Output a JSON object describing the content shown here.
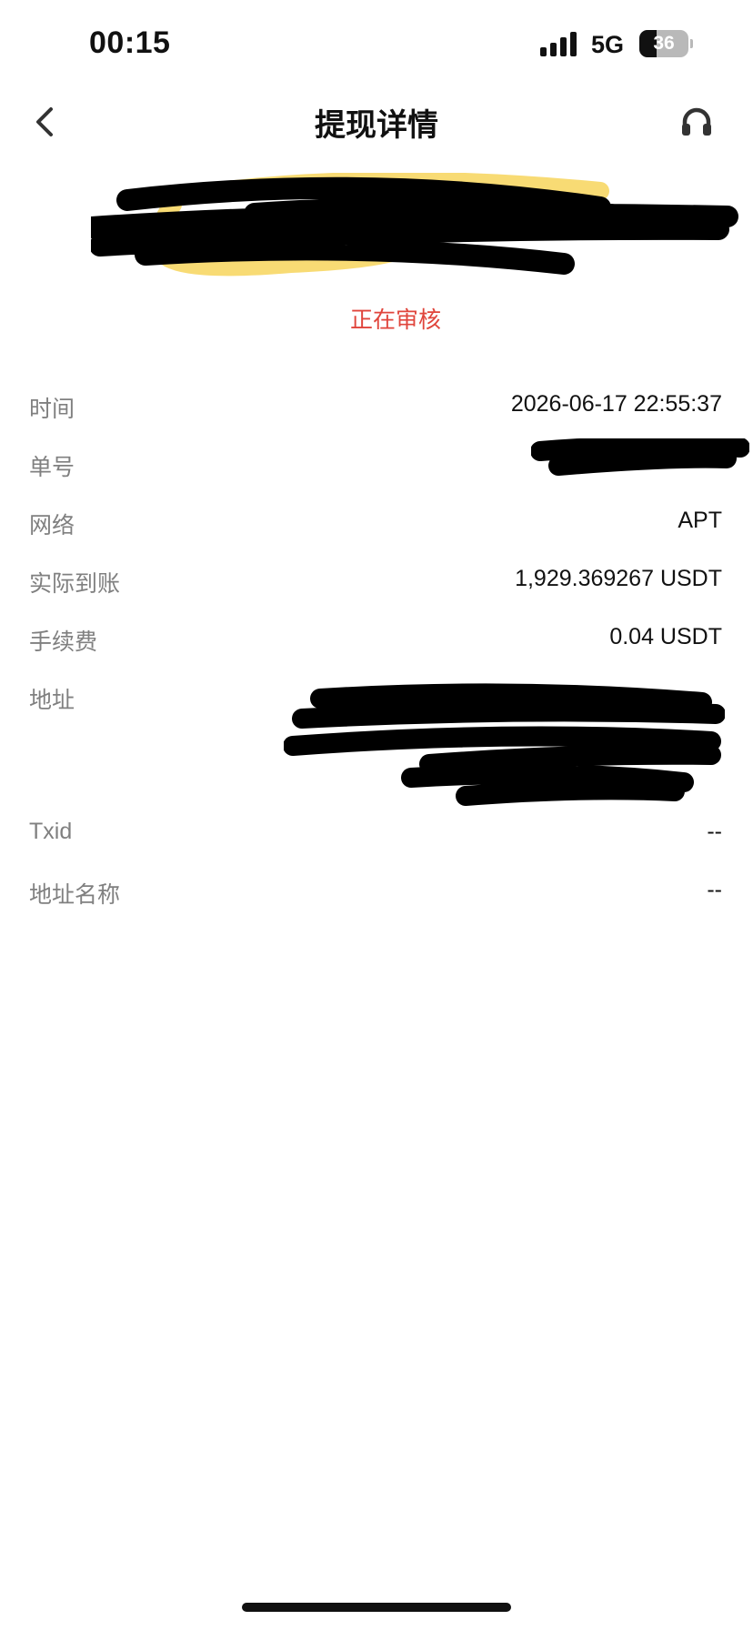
{
  "status_bar": {
    "time": "00:15",
    "network": "5G",
    "battery": "36",
    "battery_level": 0.36
  },
  "nav": {
    "title": "提现详情",
    "back_icon": "chevron-left-icon",
    "support_icon": "headset-icon"
  },
  "summary": {
    "status": "正在审核",
    "status_color": "#e0453c"
  },
  "details": {
    "time": {
      "label": "时间",
      "value": "2026-06-17 22:55:37"
    },
    "order_no": {
      "label": "单号"
    },
    "network": {
      "label": "网络",
      "value": "APT"
    },
    "received": {
      "label": "实际到账",
      "value": "1,929.369267 USDT"
    },
    "fee": {
      "label": "手续费",
      "value": "0.04 USDT"
    },
    "address": {
      "label": "地址"
    },
    "txid": {
      "label": "Txid",
      "value": "--"
    },
    "address_name": {
      "label": "地址名称",
      "value": "--"
    }
  }
}
